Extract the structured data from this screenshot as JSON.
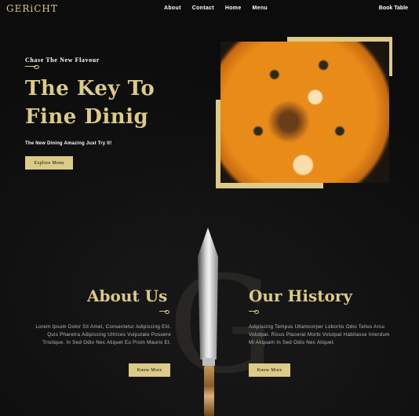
{
  "nav": {
    "logo": "GERiCHT",
    "links": [
      "About",
      "Contact",
      "Home",
      "Menu"
    ],
    "book": "Book Table"
  },
  "hero": {
    "subtitle": "Chase The New Flavour",
    "title": "The Key To Fine Dinig",
    "description": "The New Dining Amazing Just Try It!",
    "button": "Explore Menu"
  },
  "about": {
    "title": "About Us",
    "text": "Lorem Ipsum Dolor Sit Amet, Consectetur Adipiscing Elit. Quis Pharetra Adipiscing Ultrices Vulputate Posuere Tristique. In Sed Odio Nec Aliquet Eu Proin Mauris Et.",
    "button": "Know More"
  },
  "history": {
    "title": "Our History",
    "text": "Adipiscing Tempus Ullamcorper Lobortis Odio Tellus Arcu Volutpat. Risus Placerat Morbi Volutpat Habitasse Interdum Mi Aliquam In Sed Odio Nec Aliquet.",
    "button": "Know More"
  },
  "decor": {
    "watermark": "G"
  },
  "colors": {
    "accent": "#dcca87",
    "background": "#0c0c0c"
  }
}
